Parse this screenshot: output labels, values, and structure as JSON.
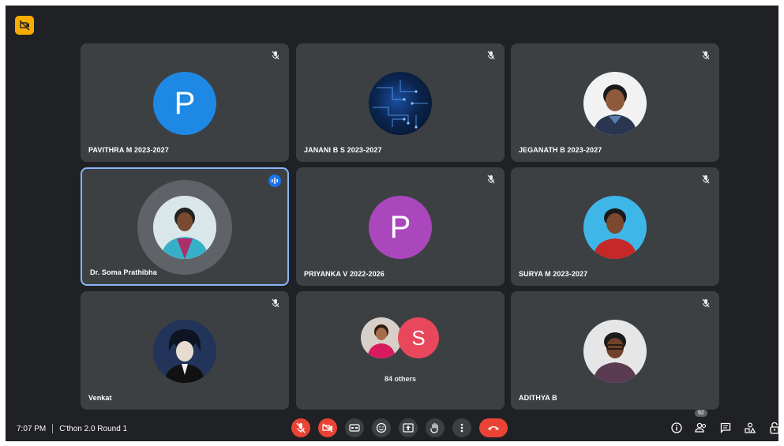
{
  "meeting": {
    "time": "7:07 PM",
    "title": "C'thon 2.0 Round 1",
    "participant_count": "92"
  },
  "tiles": {
    "t1": {
      "name": "PAVITHRA M 2023-2027",
      "initial": "P",
      "avatar_color": "#1e88e5"
    },
    "t2": {
      "name": "JANANI B S 2023-2027"
    },
    "t3": {
      "name": "JEGANATH B 2023-2027"
    },
    "t4": {
      "name": "Dr. Soma Prathibha"
    },
    "t5": {
      "name": "PRIYANKA V 2022-2026",
      "initial": "P",
      "avatar_color": "#ab47bc"
    },
    "t6": {
      "name": "SURYA M 2023-2027"
    },
    "t7": {
      "name": "Venkat"
    },
    "t8": {
      "initial": "S",
      "avatar_color": "#e8475c",
      "others_label": "84 others"
    },
    "t9": {
      "name": "ADITHYA B"
    }
  },
  "colors": {
    "background": "#202124",
    "tile": "#3c4043",
    "active_border": "#8ab4f8",
    "end_call": "#ea4335",
    "badge": "#f9ab00"
  },
  "icons": {
    "controls": [
      "mic-off-icon",
      "camera-off-icon",
      "captions-icon",
      "emoji-icon",
      "present-icon",
      "raise-hand-icon",
      "more-options-icon",
      "end-call-icon"
    ],
    "right": [
      "info-icon",
      "people-icon",
      "chat-icon",
      "activities-icon",
      "host-controls-icon"
    ]
  }
}
